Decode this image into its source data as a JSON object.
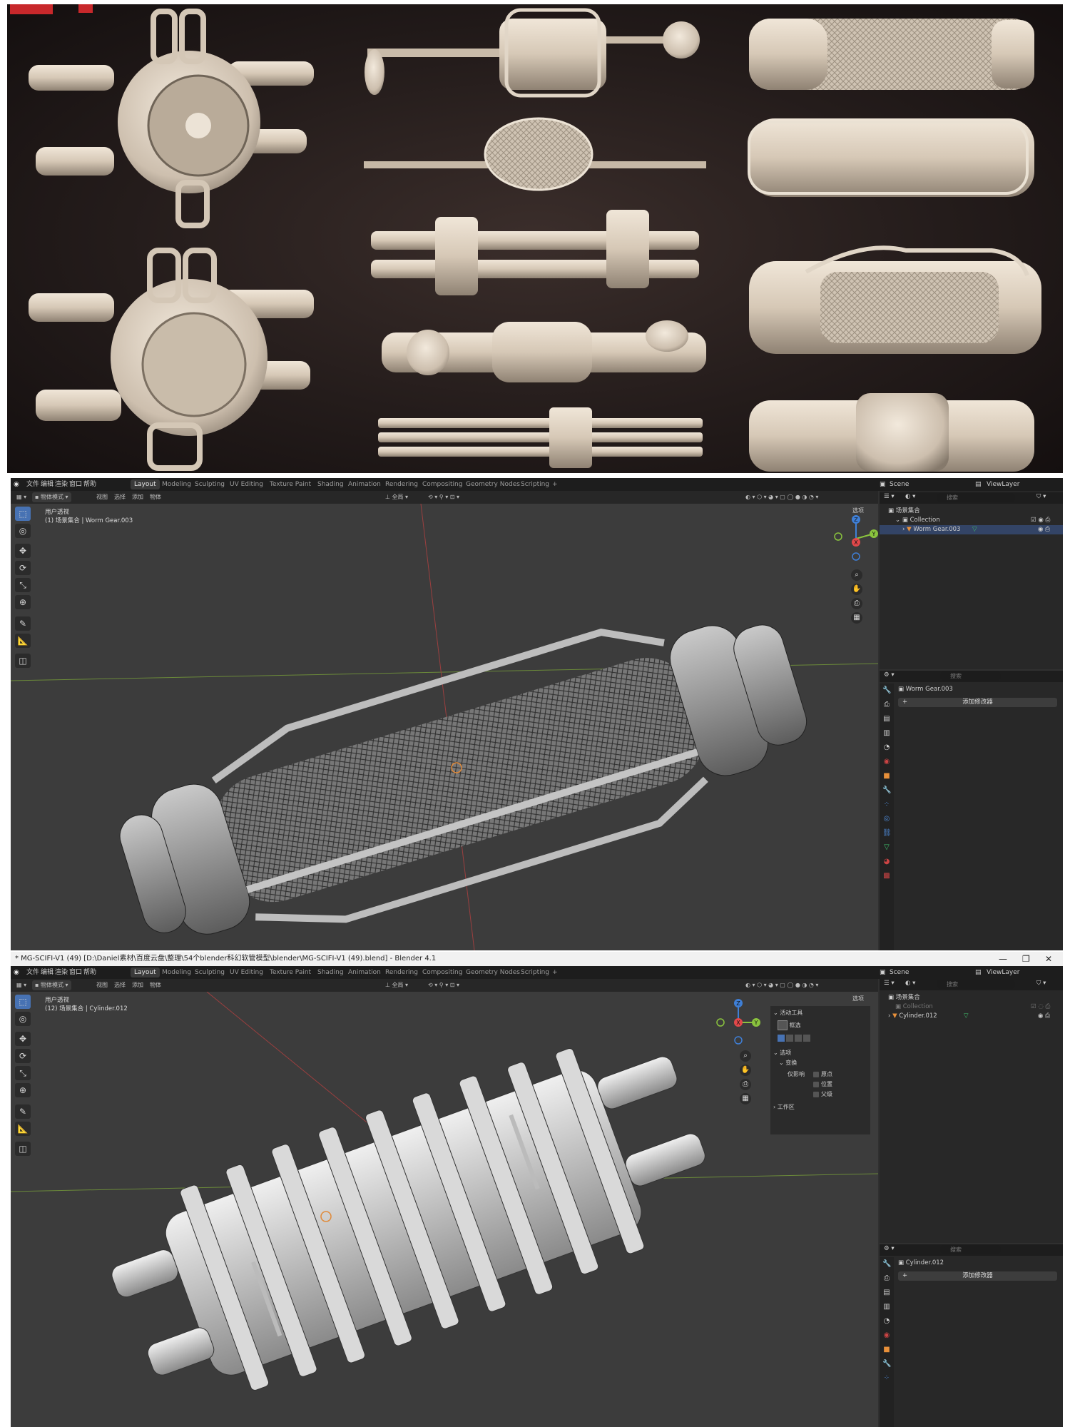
{
  "render_panel": {
    "description_colors": {
      "background": "#241c1b",
      "part": "#d8cbbb",
      "shadow": "#8d8173"
    }
  },
  "window_title": "* MG-SCIFI-V1 (49) [D:\\Daniel素材\\百度云盘\\整理\\54个blender科幻软管模型\\blender\\MG-SCIFI-V1 (49).blend] - Blender 4.1",
  "menu": [
    "文件",
    "编辑",
    "渲染",
    "窗口",
    "帮助"
  ],
  "workspaces": [
    "Layout",
    "Modeling",
    "Sculpting",
    "UV Editing",
    "Texture Paint",
    "Shading",
    "Animation",
    "Rendering",
    "Compositing",
    "Geometry Nodes",
    "Scripting",
    "+"
  ],
  "scene_label": "Scene",
  "viewlayer_label": "ViewLayer",
  "header": {
    "mode": "物体模式",
    "items": [
      "视图",
      "选择",
      "添加",
      "物体"
    ],
    "orientation": "全局",
    "options": "选项"
  },
  "viewport1": {
    "view_name": "用户透视",
    "collection_line": "(1) 场景集合 | Worm Gear.003"
  },
  "viewport2": {
    "view_name": "用户透视",
    "collection_line": "(12) 场景集合 | Cylinder.012",
    "side_panel": {
      "active_tool": "活动工具",
      "tool_name": "框选",
      "options": "选项",
      "transform": "变换",
      "affect_only": "仅影响",
      "origins": "原点",
      "locations": "位置",
      "parents": "父级",
      "workspace": "工作区"
    }
  },
  "outliner1": {
    "search_placeholder": "搜索",
    "scene_collection": "场景集合",
    "collection": "Collection",
    "object": "Worm Gear.003"
  },
  "outliner2": {
    "search_placeholder": "搜索",
    "scene_collection": "场景集合",
    "collection": "Collection",
    "object": "Cylinder.012"
  },
  "properties1": {
    "search_placeholder": "搜索",
    "object_name": "Worm Gear.003",
    "add_modifier": "添加修改器"
  },
  "properties2": {
    "search_placeholder": "搜索",
    "object_name": "Cylinder.012",
    "add_modifier": "添加修改器"
  },
  "gizmo": {
    "x": "X",
    "y": "Y",
    "z": "Z"
  },
  "colors": {
    "ui_dark": "#1d1d1d",
    "viewport": "#3c3c3c",
    "active_blue": "#4772b3",
    "axis_x": "#e2484a",
    "axis_y": "#8ac33e",
    "axis_z": "#3f7fd6"
  }
}
